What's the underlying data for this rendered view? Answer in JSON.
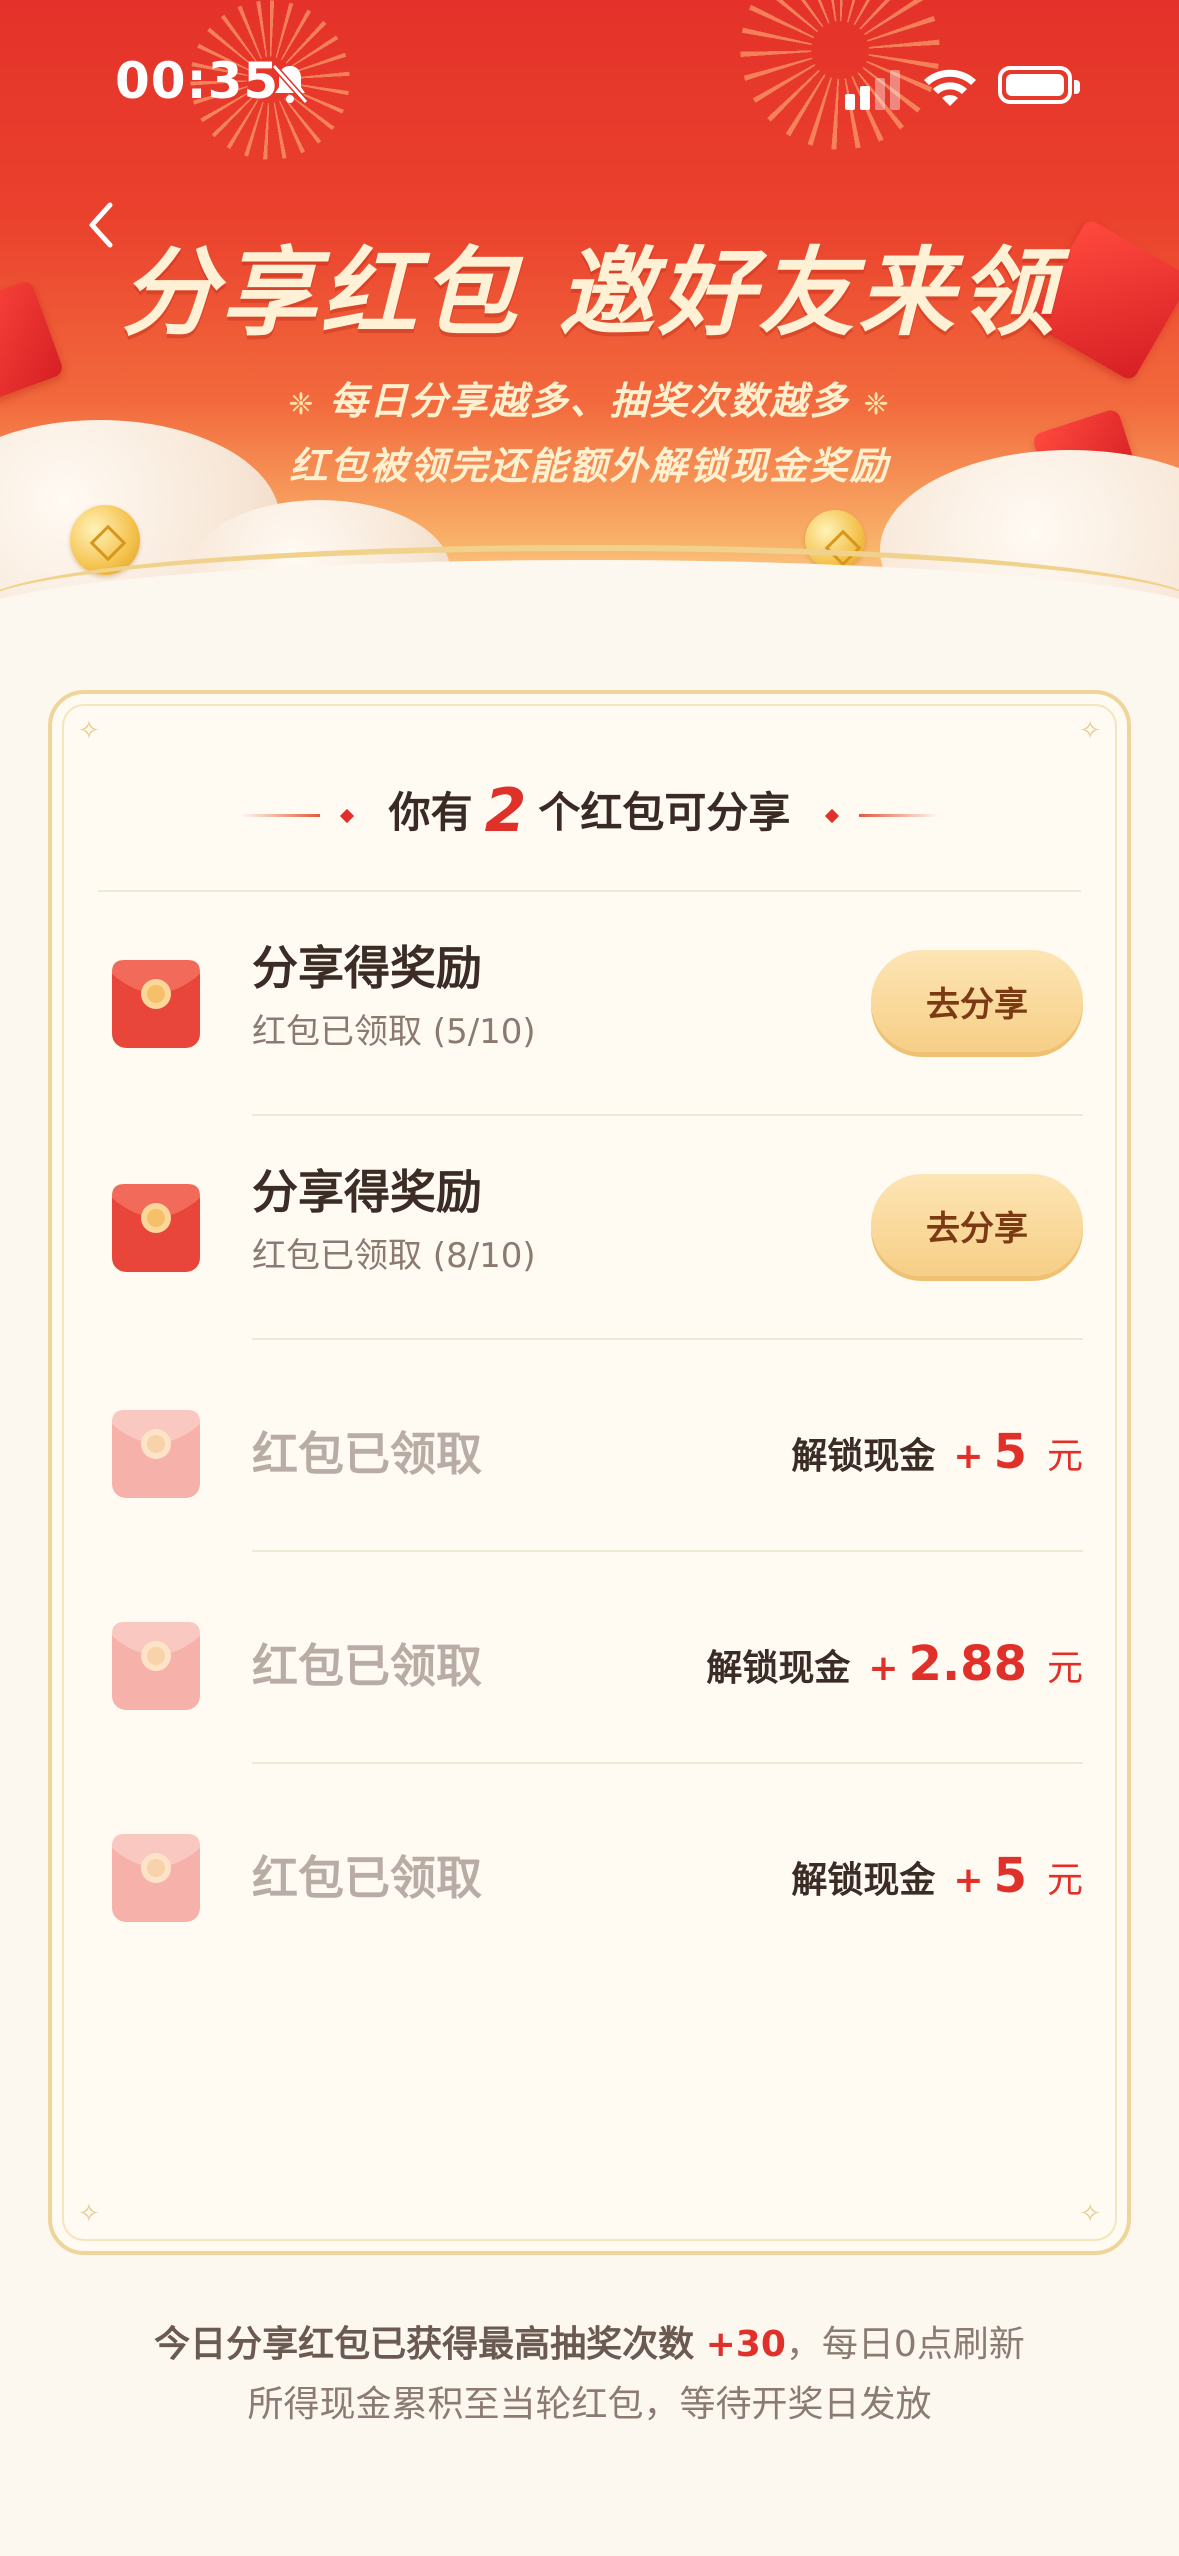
{
  "status_bar": {
    "time": "00:35"
  },
  "header": {
    "title": "分享红包 邀好友来领",
    "subtitle_line1": "每日分享越多、抽奖次数越多",
    "subtitle_line2": "红包被领完还能额外解锁现金奖励"
  },
  "card": {
    "heading_prefix": "你有",
    "heading_count": "2",
    "heading_suffix": "个红包可分享",
    "share_items": [
      {
        "title": "分享得奖励",
        "progress": "红包已领取 (5/10)",
        "button": "去分享"
      },
      {
        "title": "分享得奖励",
        "progress": "红包已领取 (8/10)",
        "button": "去分享"
      }
    ],
    "claimed_items": [
      {
        "title": "红包已领取",
        "cash_label": "解锁现金",
        "plus": "+",
        "amount": "5",
        "unit": "元"
      },
      {
        "title": "红包已领取",
        "cash_label": "解锁现金",
        "plus": "+",
        "amount": "2.88",
        "unit": "元"
      },
      {
        "title": "红包已领取",
        "cash_label": "解锁现金",
        "plus": "+",
        "amount": "5",
        "unit": "元"
      }
    ]
  },
  "footer": {
    "line1_text": "今日分享红包已获得最高抽奖次数",
    "line1_value": "+30",
    "line1_tail": "，每日0点刷新",
    "line2": "所得现金累积至当轮红包，等待开奖日发放"
  },
  "colors": {
    "accent_red": "#e0302a",
    "hero_red": "#e4322a",
    "button_gold": "#f6cf86",
    "frame_gold": "#f0d59a"
  }
}
